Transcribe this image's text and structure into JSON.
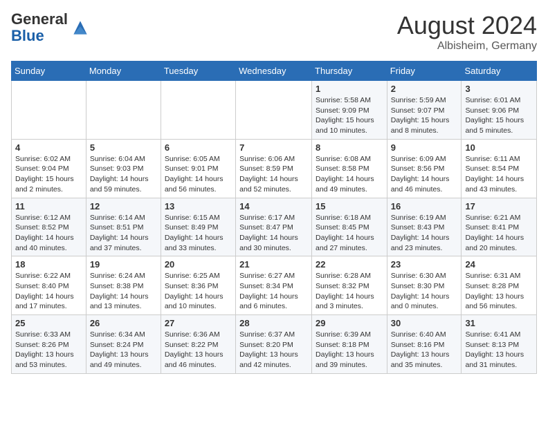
{
  "header": {
    "logo_general": "General",
    "logo_blue": "Blue",
    "month_year": "August 2024",
    "location": "Albisheim, Germany"
  },
  "calendar": {
    "days_of_week": [
      "Sunday",
      "Monday",
      "Tuesday",
      "Wednesday",
      "Thursday",
      "Friday",
      "Saturday"
    ],
    "weeks": [
      [
        {
          "day": "",
          "info": ""
        },
        {
          "day": "",
          "info": ""
        },
        {
          "day": "",
          "info": ""
        },
        {
          "day": "",
          "info": ""
        },
        {
          "day": "1",
          "info": "Sunrise: 5:58 AM\nSunset: 9:09 PM\nDaylight: 15 hours\nand 10 minutes."
        },
        {
          "day": "2",
          "info": "Sunrise: 5:59 AM\nSunset: 9:07 PM\nDaylight: 15 hours\nand 8 minutes."
        },
        {
          "day": "3",
          "info": "Sunrise: 6:01 AM\nSunset: 9:06 PM\nDaylight: 15 hours\nand 5 minutes."
        }
      ],
      [
        {
          "day": "4",
          "info": "Sunrise: 6:02 AM\nSunset: 9:04 PM\nDaylight: 15 hours\nand 2 minutes."
        },
        {
          "day": "5",
          "info": "Sunrise: 6:04 AM\nSunset: 9:03 PM\nDaylight: 14 hours\nand 59 minutes."
        },
        {
          "day": "6",
          "info": "Sunrise: 6:05 AM\nSunset: 9:01 PM\nDaylight: 14 hours\nand 56 minutes."
        },
        {
          "day": "7",
          "info": "Sunrise: 6:06 AM\nSunset: 8:59 PM\nDaylight: 14 hours\nand 52 minutes."
        },
        {
          "day": "8",
          "info": "Sunrise: 6:08 AM\nSunset: 8:58 PM\nDaylight: 14 hours\nand 49 minutes."
        },
        {
          "day": "9",
          "info": "Sunrise: 6:09 AM\nSunset: 8:56 PM\nDaylight: 14 hours\nand 46 minutes."
        },
        {
          "day": "10",
          "info": "Sunrise: 6:11 AM\nSunset: 8:54 PM\nDaylight: 14 hours\nand 43 minutes."
        }
      ],
      [
        {
          "day": "11",
          "info": "Sunrise: 6:12 AM\nSunset: 8:52 PM\nDaylight: 14 hours\nand 40 minutes."
        },
        {
          "day": "12",
          "info": "Sunrise: 6:14 AM\nSunset: 8:51 PM\nDaylight: 14 hours\nand 37 minutes."
        },
        {
          "day": "13",
          "info": "Sunrise: 6:15 AM\nSunset: 8:49 PM\nDaylight: 14 hours\nand 33 minutes."
        },
        {
          "day": "14",
          "info": "Sunrise: 6:17 AM\nSunset: 8:47 PM\nDaylight: 14 hours\nand 30 minutes."
        },
        {
          "day": "15",
          "info": "Sunrise: 6:18 AM\nSunset: 8:45 PM\nDaylight: 14 hours\nand 27 minutes."
        },
        {
          "day": "16",
          "info": "Sunrise: 6:19 AM\nSunset: 8:43 PM\nDaylight: 14 hours\nand 23 minutes."
        },
        {
          "day": "17",
          "info": "Sunrise: 6:21 AM\nSunset: 8:41 PM\nDaylight: 14 hours\nand 20 minutes."
        }
      ],
      [
        {
          "day": "18",
          "info": "Sunrise: 6:22 AM\nSunset: 8:40 PM\nDaylight: 14 hours\nand 17 minutes."
        },
        {
          "day": "19",
          "info": "Sunrise: 6:24 AM\nSunset: 8:38 PM\nDaylight: 14 hours\nand 13 minutes."
        },
        {
          "day": "20",
          "info": "Sunrise: 6:25 AM\nSunset: 8:36 PM\nDaylight: 14 hours\nand 10 minutes."
        },
        {
          "day": "21",
          "info": "Sunrise: 6:27 AM\nSunset: 8:34 PM\nDaylight: 14 hours\nand 6 minutes."
        },
        {
          "day": "22",
          "info": "Sunrise: 6:28 AM\nSunset: 8:32 PM\nDaylight: 14 hours\nand 3 minutes."
        },
        {
          "day": "23",
          "info": "Sunrise: 6:30 AM\nSunset: 8:30 PM\nDaylight: 14 hours\nand 0 minutes."
        },
        {
          "day": "24",
          "info": "Sunrise: 6:31 AM\nSunset: 8:28 PM\nDaylight: 13 hours\nand 56 minutes."
        }
      ],
      [
        {
          "day": "25",
          "info": "Sunrise: 6:33 AM\nSunset: 8:26 PM\nDaylight: 13 hours\nand 53 minutes."
        },
        {
          "day": "26",
          "info": "Sunrise: 6:34 AM\nSunset: 8:24 PM\nDaylight: 13 hours\nand 49 minutes."
        },
        {
          "day": "27",
          "info": "Sunrise: 6:36 AM\nSunset: 8:22 PM\nDaylight: 13 hours\nand 46 minutes."
        },
        {
          "day": "28",
          "info": "Sunrise: 6:37 AM\nSunset: 8:20 PM\nDaylight: 13 hours\nand 42 minutes."
        },
        {
          "day": "29",
          "info": "Sunrise: 6:39 AM\nSunset: 8:18 PM\nDaylight: 13 hours\nand 39 minutes."
        },
        {
          "day": "30",
          "info": "Sunrise: 6:40 AM\nSunset: 8:16 PM\nDaylight: 13 hours\nand 35 minutes."
        },
        {
          "day": "31",
          "info": "Sunrise: 6:41 AM\nSunset: 8:13 PM\nDaylight: 13 hours\nand 31 minutes."
        }
      ]
    ]
  }
}
